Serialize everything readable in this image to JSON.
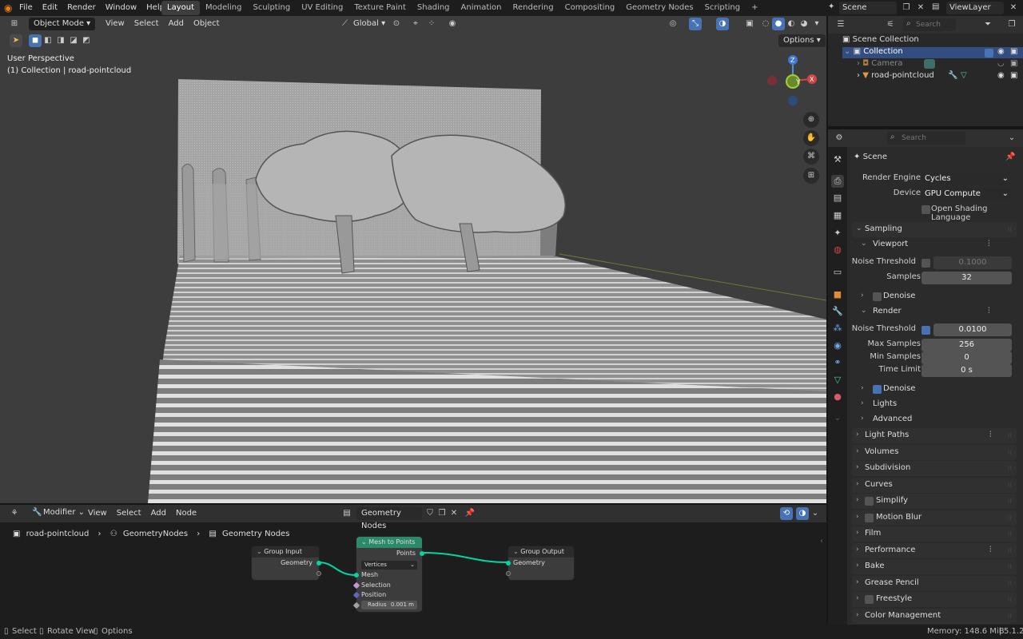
{
  "topbar": {
    "menus": [
      "File",
      "Edit",
      "Render",
      "Window",
      "Help"
    ],
    "workspaces": [
      "Layout",
      "Modeling",
      "Sculpting",
      "UV Editing",
      "Texture Paint",
      "Shading",
      "Animation",
      "Rendering",
      "Compositing",
      "Geometry Nodes",
      "Scripting"
    ],
    "active_workspace": "Layout",
    "add_tab": "+",
    "scene": "Scene",
    "view_layer": "ViewLayer"
  },
  "viewport": {
    "mode": "Object Mode",
    "menus": [
      "View",
      "Select",
      "Add",
      "Object"
    ],
    "transform_orientation": "Global",
    "options_label": "Options",
    "perspective_label": "User Perspective",
    "collection_label": "(1) Collection | road-pointcloud",
    "gizmo": {
      "x": "X",
      "y": "Y",
      "z": "Z"
    }
  },
  "outliner": {
    "search_placeholder": "Search",
    "root": "Scene Collection",
    "collection": "Collection",
    "items": [
      "Camera",
      "road-pointcloud"
    ]
  },
  "properties": {
    "search_placeholder": "Search",
    "context": "Scene",
    "render_engine_label": "Render Engine",
    "render_engine": "Cycles",
    "device_label": "Device",
    "device": "GPU Compute",
    "osl_label": "Open Shading Language",
    "sampling": "Sampling",
    "viewport": "Viewport",
    "vp_noise_label": "Noise Threshold",
    "vp_noise": "0.1000",
    "vp_samples_label": "Samples",
    "vp_samples": "32",
    "vp_denoise": "Denoise",
    "render": "Render",
    "r_noise_label": "Noise Threshold",
    "r_noise": "0.0100",
    "max_samples_label": "Max Samples",
    "max_samples": "256",
    "min_samples_label": "Min Samples",
    "min_samples": "0",
    "time_limit_label": "Time Limit",
    "time_limit": "0 s",
    "r_denoise": "Denoise",
    "lights": "Lights",
    "advanced": "Advanced",
    "panels": [
      "Light Paths",
      "Volumes",
      "Subdivision",
      "Curves",
      "Simplify",
      "Motion Blur",
      "Film",
      "Performance",
      "Bake",
      "Grease Pencil",
      "Freestyle",
      "Color Management"
    ]
  },
  "node_editor": {
    "editor_type": "Modifier",
    "menus": [
      "View",
      "Select",
      "Add",
      "Node"
    ],
    "tree_name": "Geometry Nodes",
    "breadcrumbs": [
      "road-pointcloud",
      "GeometryNodes",
      "Geometry Nodes"
    ],
    "group_input": {
      "title": "Group Input",
      "socket": "Geometry"
    },
    "mesh_to_points": {
      "title": "Mesh to Points",
      "out": "Points",
      "mode": "Vertices",
      "mesh": "Mesh",
      "selection": "Selection",
      "position": "Position",
      "radius_label": "Radius",
      "radius": "0.001 m"
    },
    "group_output": {
      "title": "Group Output",
      "socket": "Geometry"
    }
  },
  "statusbar": {
    "select": "Select",
    "rotate": "Rotate View",
    "options": "Options",
    "memory": "Memory: 148.6 MiB",
    "version": "5.1.2"
  },
  "colors": {
    "accent": "#4772b3",
    "node_green": "#2b8a6a",
    "geometry_socket": "#00d6a3"
  }
}
